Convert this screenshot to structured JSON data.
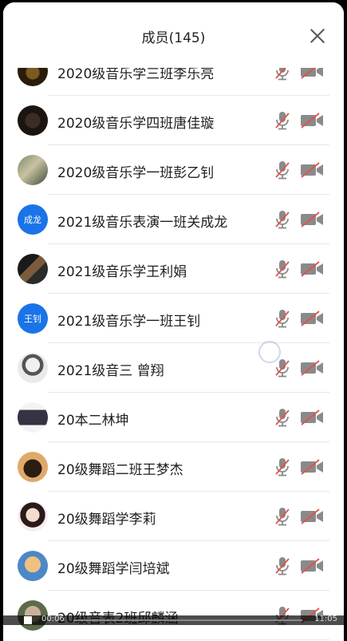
{
  "header": {
    "title": "成员(145)"
  },
  "members": [
    {
      "name": "2020级音乐学三班李乐亮",
      "avatar": "photo-dark-gold"
    },
    {
      "name": "2020级音乐学四班唐佳璇",
      "avatar": "photo-dark-circle"
    },
    {
      "name": "2020级音乐学一班彭乙钊",
      "avatar": "photo-outdoor"
    },
    {
      "name": "2021级音乐表演一班关成龙",
      "avatar": "initials",
      "initials": "成龙"
    },
    {
      "name": "2021级音乐学王利娟",
      "avatar": "photo-collage"
    },
    {
      "name": "2021级音乐学一班王钊",
      "avatar": "initials",
      "initials": "王钊"
    },
    {
      "name": "2021级音三  曾翔",
      "avatar": "photo-sketch"
    },
    {
      "name": "20本二林坤",
      "avatar": "photo-window"
    },
    {
      "name": "20级舞蹈二班王梦杰",
      "avatar": "photo-bear"
    },
    {
      "name": "20级舞蹈学李莉",
      "avatar": "photo-girl"
    },
    {
      "name": "20级舞蹈学闫培斌",
      "avatar": "photo-cartoon"
    },
    {
      "name": "20级音表2班邱麟涵",
      "avatar": "photo-cat"
    }
  ],
  "icons": {
    "mic": "mic-muted-icon",
    "camera": "camera-off-icon",
    "close": "close-icon"
  },
  "colors": {
    "initials_bg": "#1a73e8",
    "mute_slash": "#e0524b",
    "icon_gray": "#8a8a8a"
  },
  "video_bar": {
    "elapsed": "00:06",
    "total": "11:05"
  }
}
